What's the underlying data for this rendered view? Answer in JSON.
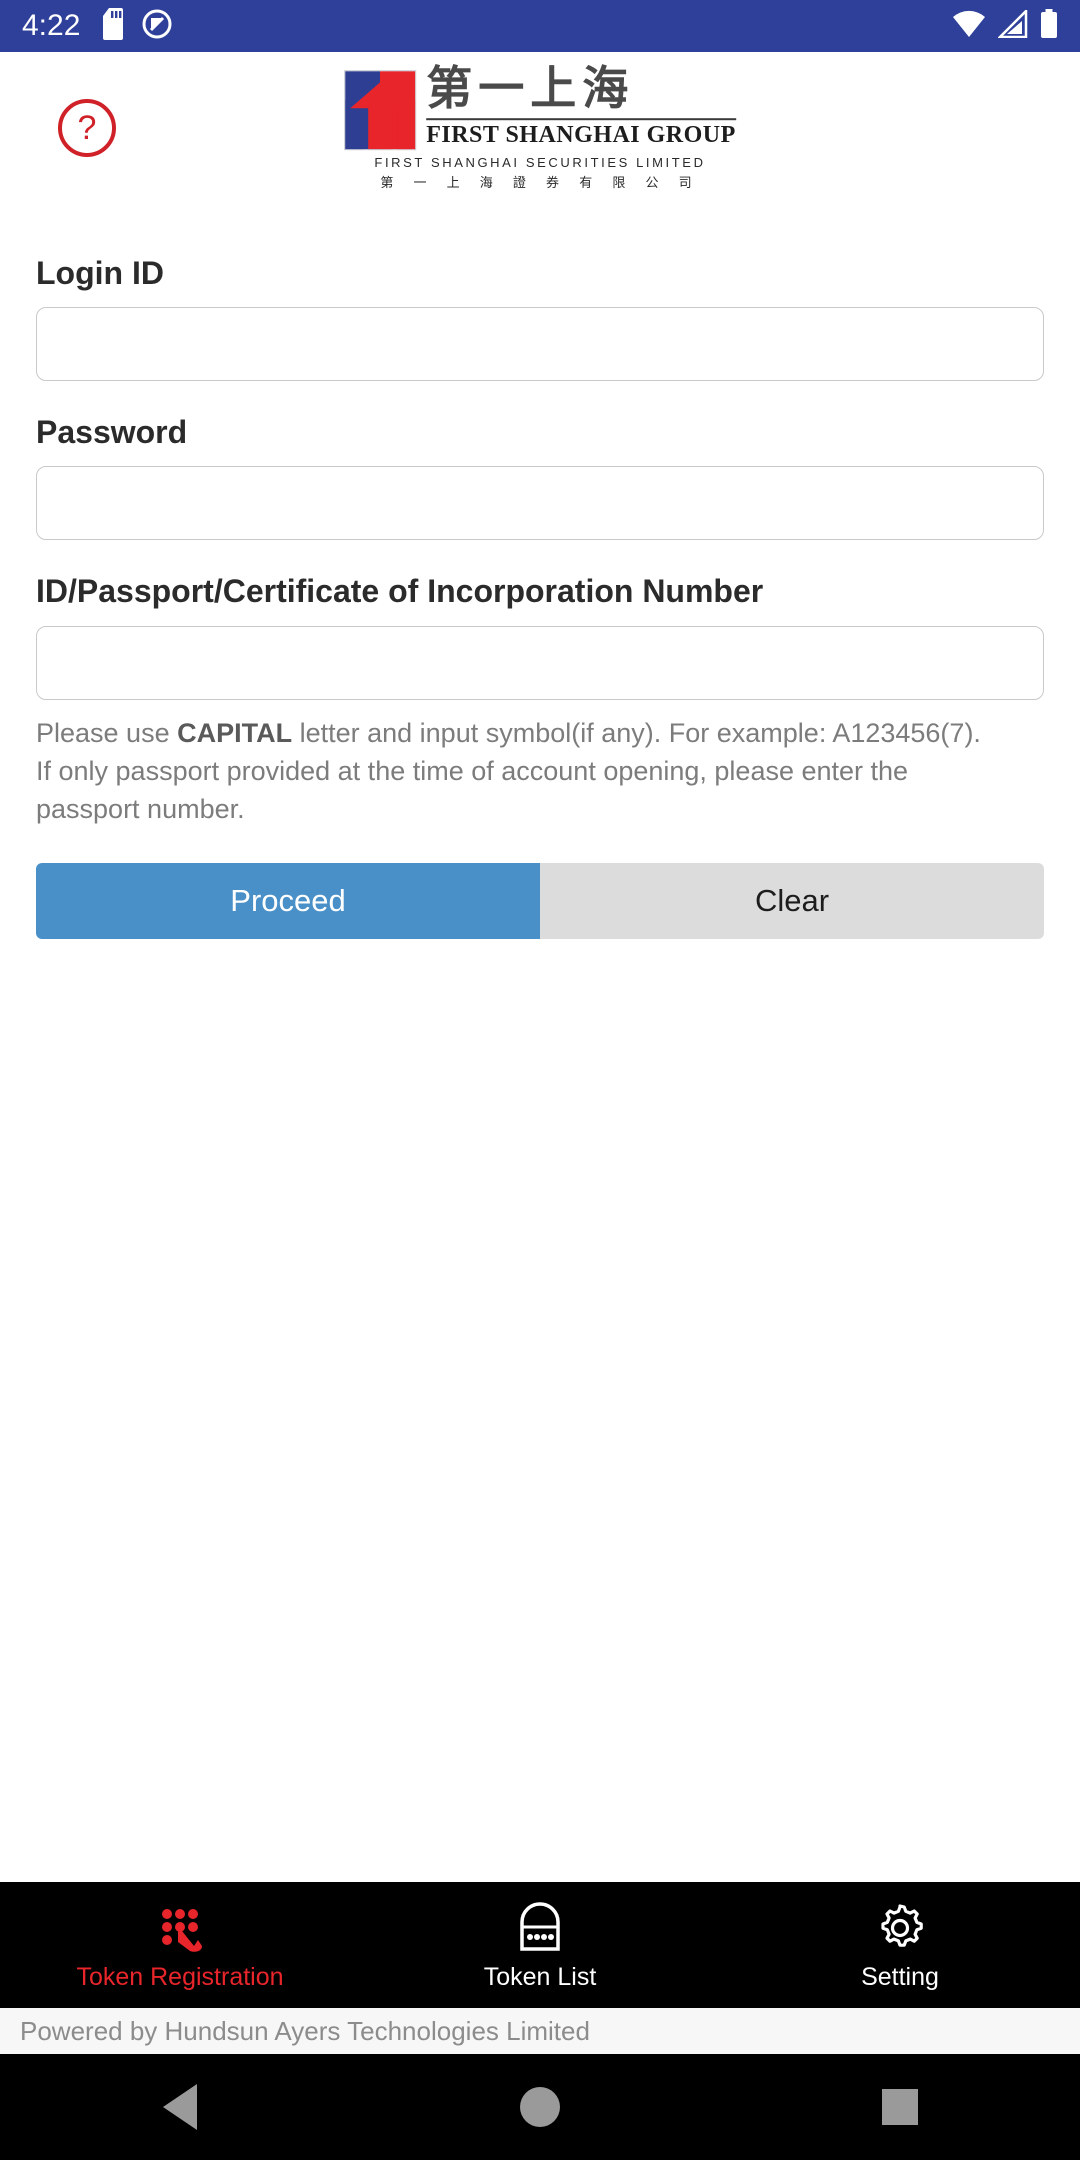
{
  "status_bar": {
    "time": "4:22",
    "background_color": "#2e409a",
    "left_icons": [
      "sd-card-icon",
      "do-not-disturb-icon"
    ],
    "right_icons": [
      "wifi-icon",
      "cellular-signal-icon",
      "battery-icon"
    ]
  },
  "header": {
    "help_icon_label": "?",
    "help_icon_color": "#cf2127",
    "logo": {
      "chinese_name": "第一上海",
      "group_name": "FIRST SHANGHAI GROUP",
      "securities_en": "FIRST SHANGHAI SECURITIES LIMITED",
      "securities_cn": "第 一 上 海 證 券 有 限 公 司",
      "mark_blue": "#2e3f93",
      "mark_red": "#e8252a"
    }
  },
  "form": {
    "login_id": {
      "label": "Login ID",
      "value": "",
      "placeholder": ""
    },
    "password": {
      "label": "Password",
      "value": "",
      "placeholder": ""
    },
    "id_number": {
      "label": "ID/Passport/Certificate of Incorporation Number",
      "value": "",
      "placeholder": "",
      "helper_prefix": "Please use ",
      "helper_bold": "CAPITAL",
      "helper_suffix": " letter and input symbol(if any). For example: A123456(7). If only passport provided at the time of account opening, please enter the passport number."
    },
    "buttons": {
      "proceed": "Proceed",
      "clear": "Clear",
      "proceed_color": "#4a90c8",
      "clear_color": "#dcdcdc"
    }
  },
  "tabbar": {
    "background_color": "#000000",
    "active_color": "#e8252a",
    "inactive_color": "#ffffff",
    "items": [
      {
        "label": "Token Registration",
        "icon": "keypad-touch-icon",
        "active": true
      },
      {
        "label": "Token List",
        "icon": "token-lock-icon",
        "active": false
      },
      {
        "label": "Setting",
        "icon": "gear-icon",
        "active": false
      }
    ]
  },
  "footer": {
    "text": "Powered by Hundsun Ayers Technologies Limited"
  },
  "android_nav": {
    "back": "back-button",
    "home": "home-button",
    "recents": "recents-button"
  }
}
